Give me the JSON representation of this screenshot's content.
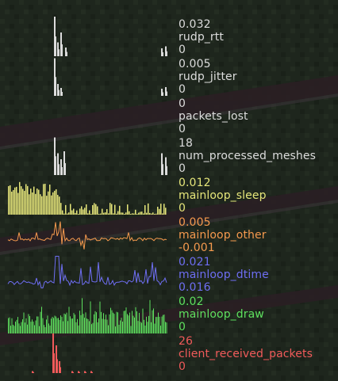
{
  "hud": {
    "graphs": [
      {
        "name": "rudp_rtt",
        "max": "0.032",
        "min": "0",
        "color": "#dcdcdc",
        "spikes": [
          {
            "pos": 0.29,
            "h": 1.0
          },
          {
            "pos": 0.31,
            "h": 0.35
          },
          {
            "pos": 0.33,
            "h": 0.6
          },
          {
            "pos": 0.36,
            "h": 0.22
          },
          {
            "pos": 0.965,
            "h": 0.2
          },
          {
            "pos": 0.99,
            "h": 0.25
          }
        ]
      },
      {
        "name": "rudp_jitter",
        "max": "0.005",
        "min": "0",
        "color": "#dcdcdc",
        "spikes": [
          {
            "pos": 0.29,
            "h": 0.95
          },
          {
            "pos": 0.31,
            "h": 0.3
          },
          {
            "pos": 0.33,
            "h": 0.2
          },
          {
            "pos": 0.965,
            "h": 0.18
          },
          {
            "pos": 0.99,
            "h": 0.22
          }
        ]
      },
      {
        "name": "packets_lost",
        "max": "0",
        "min": "0",
        "color": "#dcdcdc",
        "spikes": []
      },
      {
        "name": "num_processed_meshes",
        "max": "18",
        "min": "0",
        "color": "#dcdcdc",
        "spikes": [
          {
            "pos": 0.29,
            "h": 0.95
          },
          {
            "pos": 0.31,
            "h": 0.55
          },
          {
            "pos": 0.33,
            "h": 0.4
          },
          {
            "pos": 0.35,
            "h": 0.6
          },
          {
            "pos": 0.965,
            "h": 0.55
          },
          {
            "pos": 0.99,
            "h": 0.45
          }
        ]
      },
      {
        "name": "mainloop_sleep",
        "max": "0.012",
        "min": "0",
        "color": "#e6e67a",
        "style": "bars-decay"
      },
      {
        "name": "mainloop_other",
        "max": "0.005",
        "min": "-0.001",
        "color": "#f59a4e",
        "style": "line-flat"
      },
      {
        "name": "mainloop_dtime",
        "max": "0.021",
        "min": "0.016",
        "color": "#6e6ef2",
        "style": "line-noisy"
      },
      {
        "name": "mainloop_draw",
        "max": "0.02",
        "min": "0",
        "color": "#5ee05e",
        "style": "bars-mid"
      },
      {
        "name": "client_received_packets",
        "max": "26",
        "min": "0",
        "color": "#f05a5a",
        "spikes": [
          {
            "pos": 0.28,
            "h": 1.0
          },
          {
            "pos": 0.3,
            "h": 0.7
          },
          {
            "pos": 0.32,
            "h": 0.3
          },
          {
            "pos": 0.15,
            "h": 0.05
          },
          {
            "pos": 0.4,
            "h": 0.05
          },
          {
            "pos": 0.44,
            "h": 0.05
          },
          {
            "pos": 0.48,
            "h": 0.05
          },
          {
            "pos": 0.52,
            "h": 0.05
          }
        ]
      }
    ]
  }
}
